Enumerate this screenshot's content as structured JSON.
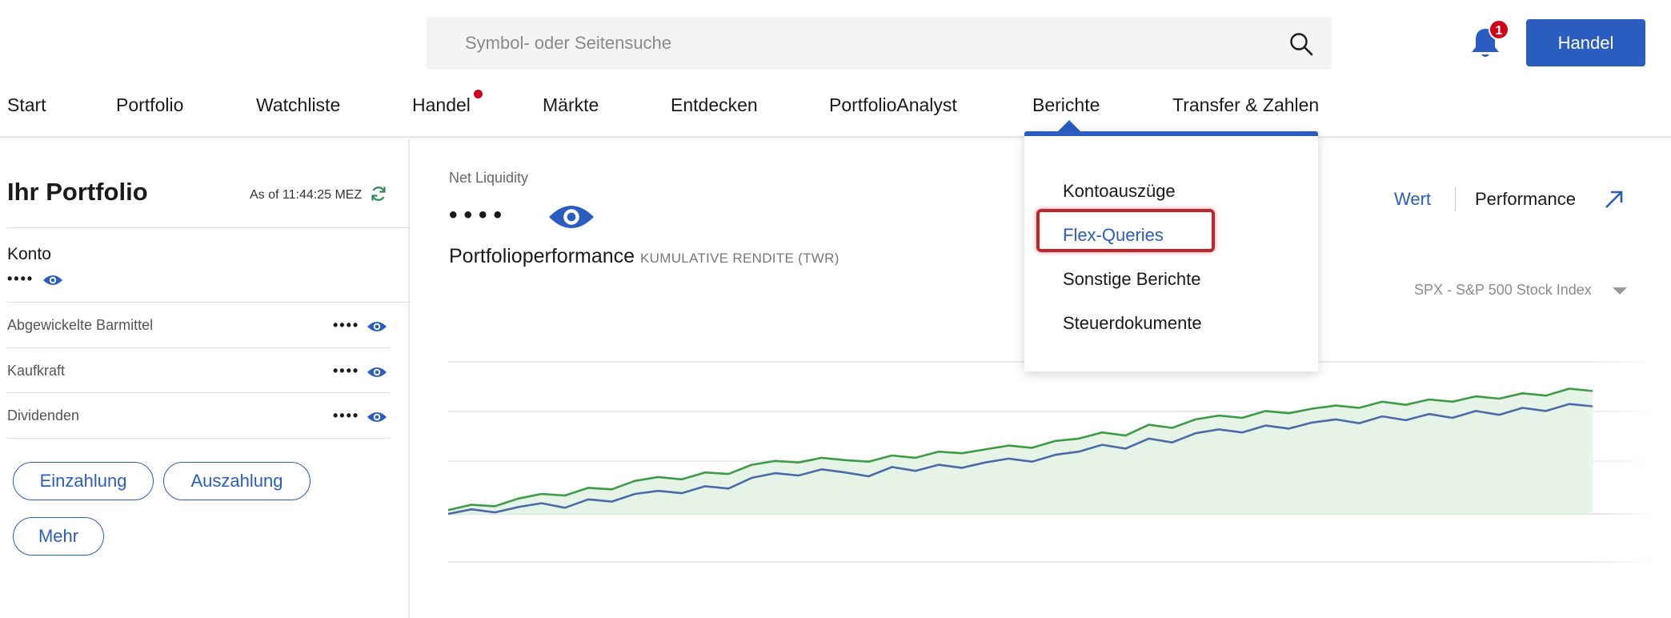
{
  "header": {
    "search_placeholder": "Symbol- oder Seitensuche",
    "notification_count": "1",
    "trade_button": "Handel"
  },
  "nav": {
    "items": [
      {
        "label": "Start"
      },
      {
        "label": "Portfolio"
      },
      {
        "label": "Watchliste"
      },
      {
        "label": "Handel"
      },
      {
        "label": "Märkte"
      },
      {
        "label": "Entdecken"
      },
      {
        "label": "PortfolioAnalyst"
      },
      {
        "label": "Berichte"
      },
      {
        "label": "Transfer & Zahlen"
      }
    ]
  },
  "dropdown": {
    "items": [
      {
        "label": "Kontoauszüge"
      },
      {
        "label": "Flex-Queries"
      },
      {
        "label": "Sonstige Berichte"
      },
      {
        "label": "Steuerdokumente"
      }
    ]
  },
  "portfolio": {
    "title": "Ihr Portfolio",
    "as_of": "As of 11:44:25 MEZ",
    "account_label": "Konto",
    "masked": "••••",
    "rows": [
      {
        "label": "Abgewickelte Barmittel",
        "value": "••••"
      },
      {
        "label": "Kaufkraft",
        "value": "••••"
      },
      {
        "label": "Dividenden",
        "value": "••••"
      }
    ],
    "buttons": {
      "deposit": "Einzahlung",
      "withdraw": "Auszahlung",
      "more": "Mehr"
    }
  },
  "main": {
    "net_liquidity_label": "Net Liquidity",
    "net_liquidity_value": "••••",
    "performance_title": "Portfolioperformance",
    "performance_subtitle": "KUMULATIVE RENDITE (TWR)",
    "toggle_value": "Wert",
    "toggle_performance": "Performance",
    "benchmark": "SPX - S&P 500 Stock Index"
  },
  "colors": {
    "accent": "#2a5dbf",
    "portfolio_line": "#3d9b45",
    "benchmark_line": "#4a6aa8",
    "area_fill": "#e6f4e8",
    "alert": "#d0021b",
    "highlight": "#c0252a"
  },
  "chart_data": {
    "type": "line",
    "series": [
      {
        "values": [
          0.5,
          1.2,
          1.0,
          2.0,
          2.6,
          2.4,
          3.4,
          3.2,
          4.3,
          4.8,
          4.5,
          5.4,
          5.2,
          6.4,
          6.9,
          6.7,
          7.3,
          7.0,
          6.8,
          7.6,
          7.3,
          8.1,
          7.9,
          8.4,
          8.9,
          8.6,
          9.5,
          9.8,
          10.6,
          10.2,
          11.6,
          11.2,
          12.3,
          12.8,
          12.5,
          13.4,
          13.1,
          13.7,
          14.1,
          13.8,
          14.6,
          14.2,
          14.9,
          14.6,
          15.3,
          15.0,
          15.7,
          15.4,
          16.3,
          16.0
        ]
      },
      {
        "values": [
          0.0,
          0.6,
          0.2,
          0.9,
          1.4,
          0.8,
          1.9,
          1.6,
          2.6,
          3.0,
          2.7,
          3.6,
          3.3,
          4.7,
          5.3,
          5.0,
          5.8,
          5.4,
          4.9,
          6.1,
          5.6,
          6.4,
          6.0,
          6.7,
          7.2,
          6.8,
          7.7,
          8.1,
          9.0,
          8.5,
          9.8,
          9.3,
          10.5,
          11.0,
          10.6,
          11.5,
          11.1,
          11.9,
          12.3,
          11.8,
          12.7,
          12.2,
          13.0,
          12.5,
          13.4,
          12.9,
          13.8,
          13.4,
          14.3,
          14.0
        ]
      }
    ],
    "ylim": [
      -2,
      20
    ]
  }
}
